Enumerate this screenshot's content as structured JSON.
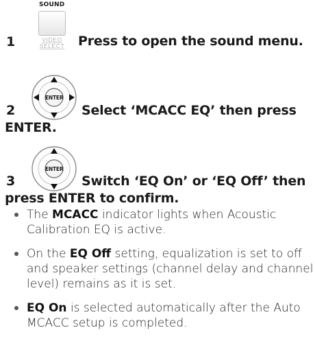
{
  "step1": {
    "number": "1",
    "button_top_label": "SOUND",
    "button_bottom_label_line1": "VIDEO",
    "button_bottom_label_line2": "SELECT",
    "text": "Press to open the sound menu."
  },
  "step2": {
    "number": "2",
    "dial_label": "ENTER",
    "text_line1": "Select ‘MCACC EQ’ then press",
    "text_line2": "ENTER."
  },
  "step3": {
    "number": "3",
    "dial_label": "ENTER",
    "text_line1": "Switch ‘EQ On’ or ‘EQ Off’ then",
    "text_line2": "press ENTER to confirm."
  },
  "bullets": {
    "b1": {
      "prefix": "The ",
      "bold": "MCACC",
      "rest": " indicator lights when Acoustic Calibration EQ is active."
    },
    "b2": {
      "prefix": "On the ",
      "bold": "EQ Off",
      "rest": " setting, equalization is set to off and speaker settings (channel delay and channel level) remains as it is set."
    },
    "b3": {
      "prefix": "",
      "bold": "EQ On",
      "rest": " is selected automatically after the Auto MCACC setup is completed."
    }
  }
}
